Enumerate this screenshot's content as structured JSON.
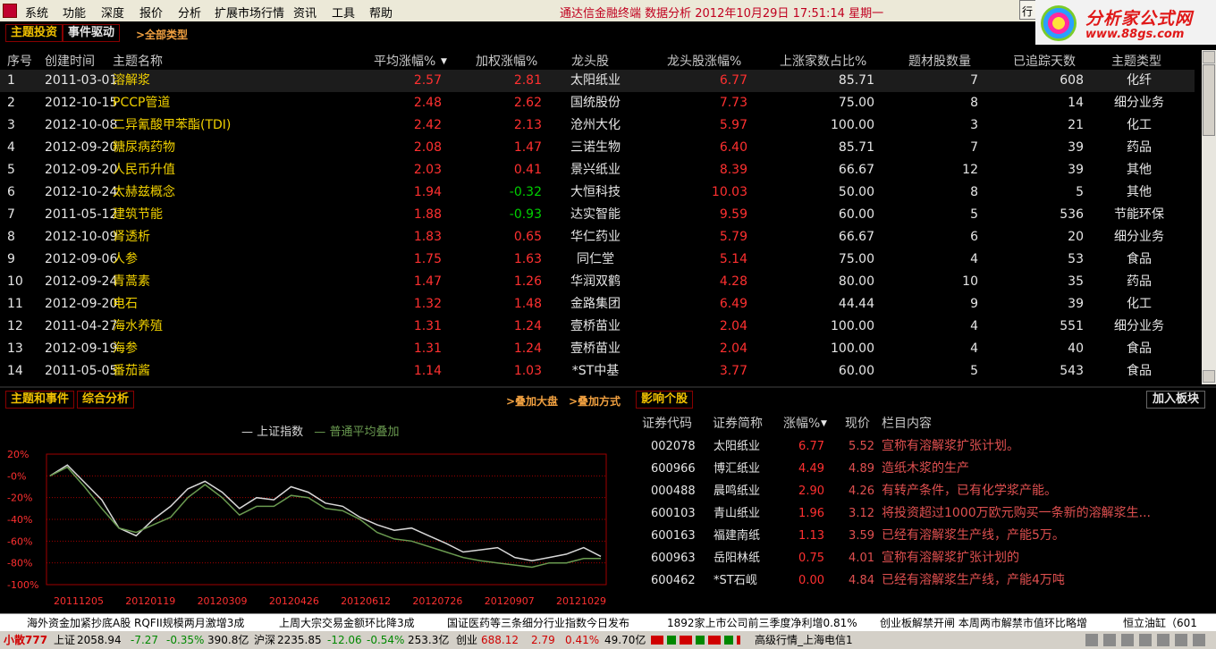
{
  "menu": [
    "系统",
    "功能",
    "深度",
    "报价",
    "分析",
    "扩展市场行情",
    "资讯",
    "工具",
    "帮助"
  ],
  "title": "通达信金融终端   数据分析  2012年10月29日  17:51:14  星期一",
  "trade_btn": "行",
  "logo": {
    "line1": "分析家公式网",
    "line2": "www.88gs.com"
  },
  "tabs": {
    "theme": "主题投资",
    "event": "事件驱动",
    "all_types": ">全部类型"
  },
  "table": {
    "headers": [
      "序号",
      "创建时间",
      "主题名称",
      "平均涨幅%",
      "加权涨幅%",
      "龙头股",
      "龙头股涨幅%",
      "上涨家数占比%",
      "题材股数量",
      "已追踪天数",
      "主题类型"
    ],
    "rows": [
      [
        "1",
        "2011-03-01",
        "溶解浆",
        "2.57",
        "2.81",
        "太阳纸业",
        "6.77",
        "85.71",
        "7",
        "608",
        "化纤"
      ],
      [
        "2",
        "2012-10-15",
        "PCCP管道",
        "2.48",
        "2.62",
        "国统股份",
        "7.73",
        "75.00",
        "8",
        "14",
        "细分业务"
      ],
      [
        "3",
        "2012-10-08",
        "二异氰酸甲苯酯(TDI)",
        "2.42",
        "2.13",
        "沧州大化",
        "5.97",
        "100.00",
        "3",
        "21",
        "化工"
      ],
      [
        "4",
        "2012-09-20",
        "糖尿病药物",
        "2.08",
        "1.47",
        "三诺生物",
        "6.40",
        "85.71",
        "7",
        "39",
        "药品"
      ],
      [
        "5",
        "2012-09-20",
        "人民币升值",
        "2.03",
        "0.41",
        "景兴纸业",
        "8.39",
        "66.67",
        "12",
        "39",
        "其他"
      ],
      [
        "6",
        "2012-10-24",
        "太赫兹概念",
        "1.94",
        "-0.32",
        "大恒科技",
        "10.03",
        "50.00",
        "8",
        "5",
        "其他"
      ],
      [
        "7",
        "2011-05-12",
        "建筑节能",
        "1.88",
        "-0.93",
        "达实智能",
        "9.59",
        "60.00",
        "5",
        "536",
        "节能环保"
      ],
      [
        "8",
        "2012-10-09",
        "肾透析",
        "1.83",
        "0.65",
        "华仁药业",
        "5.79",
        "66.67",
        "6",
        "20",
        "细分业务"
      ],
      [
        "9",
        "2012-09-06",
        "人参",
        "1.75",
        "1.63",
        "同仁堂",
        "5.14",
        "75.00",
        "4",
        "53",
        "食品"
      ],
      [
        "10",
        "2012-09-24",
        "青蒿素",
        "1.47",
        "1.26",
        "华润双鹤",
        "4.28",
        "80.00",
        "10",
        "35",
        "药品"
      ],
      [
        "11",
        "2012-09-20",
        "电石",
        "1.32",
        "1.48",
        "金路集团",
        "6.49",
        "44.44",
        "9",
        "39",
        "化工"
      ],
      [
        "12",
        "2011-04-27",
        "海水养殖",
        "1.31",
        "1.24",
        "壹桥苗业",
        "2.04",
        "100.00",
        "4",
        "551",
        "细分业务"
      ],
      [
        "13",
        "2012-09-19",
        "海参",
        "1.31",
        "1.24",
        "壹桥苗业",
        "2.04",
        "100.00",
        "4",
        "40",
        "食品"
      ],
      [
        "14",
        "2011-05-05",
        "番茄酱",
        "1.14",
        "1.03",
        "*ST中基",
        "3.77",
        "60.00",
        "5",
        "543",
        "食品"
      ]
    ]
  },
  "lower_tabs": {
    "themes_events": "主题和事件",
    "analysis": "综合分析",
    "overlay_market": ">叠加大盘",
    "overlay_mode": ">叠加方式",
    "impact": "影响个股",
    "add_board": "加入板块"
  },
  "chart_data": {
    "type": "line",
    "x": [
      "20111205",
      "20120119",
      "20120309",
      "20120426",
      "20120612",
      "20120726",
      "20120907",
      "20121029"
    ],
    "y_ticks": [
      "20%",
      "-0%",
      "-20%",
      "-40%",
      "-60%",
      "-80%",
      "-100%"
    ],
    "ylim": [
      -100,
      20
    ],
    "series": [
      {
        "name": "上证指数",
        "color": "#d8d8d8",
        "values": [
          0,
          10,
          -6,
          -22,
          -48,
          -55,
          -40,
          -28,
          -12,
          -5,
          -15,
          -30,
          -20,
          -22,
          -10,
          -15,
          -25,
          -28,
          -38,
          -45,
          -50,
          -48,
          -55,
          -62,
          -70,
          -68,
          -66,
          -75,
          -78,
          -75,
          -72,
          -66,
          -74
        ]
      },
      {
        "name": "普通平均叠加",
        "color": "#6a9a50",
        "values": [
          0,
          8,
          -10,
          -30,
          -48,
          -52,
          -45,
          -38,
          -20,
          -8,
          -20,
          -36,
          -28,
          -28,
          -18,
          -20,
          -30,
          -32,
          -40,
          -52,
          -58,
          -60,
          -65,
          -70,
          -75,
          -78,
          -80,
          -82,
          -84,
          -80,
          -80,
          -76,
          -76
        ]
      }
    ]
  },
  "impact": {
    "headers": [
      "证券代码",
      "证券简称",
      "涨幅%",
      "现价",
      "栏目内容"
    ],
    "rows": [
      [
        "002078",
        "太阳纸业",
        "6.77",
        "5.52",
        "宣称有溶解浆扩张计划。"
      ],
      [
        "600966",
        "博汇纸业",
        "4.49",
        "4.89",
        "造纸木浆的生产"
      ],
      [
        "000488",
        "晨鸣纸业",
        "2.90",
        "4.26",
        "有转产条件，已有化学浆产能。"
      ],
      [
        "600103",
        "青山纸业",
        "1.96",
        "3.12",
        "将投资超过1000万欧元购买一条新的溶解浆生..."
      ],
      [
        "600163",
        "福建南纸",
        "1.13",
        "3.59",
        "已经有溶解浆生产线，产能5万。"
      ],
      [
        "600963",
        "岳阳林纸",
        "0.75",
        "4.01",
        "宣称有溶解浆扩张计划的"
      ],
      [
        "600462",
        "*ST石岘",
        "0.00",
        "4.84",
        "已经有溶解浆生产线，产能4万吨"
      ]
    ]
  },
  "ticker": [
    "海外资金加紧抄底A股 RQFII规模两月激增3成",
    "上周大宗交易金额环比降3成",
    "国证医药等三条细分行业指数今日发布",
    "1892家上市公司前三季度净利增0.81%",
    "创业板解禁开闸 本周两市解禁市值环比略增",
    "恒立油缸（601"
  ],
  "status": {
    "xiaosan": "小散777",
    "sh_label": "上证",
    "sh_val": "2058.94",
    "sh_chg": "-7.27",
    "sh_pct": "-0.35%",
    "sh_amt": "390.8亿",
    "hs_label": "沪深",
    "hs_val": "2235.85",
    "hs_chg": "-12.06",
    "hs_pct": "-0.54%",
    "hs_amt": "253.3亿",
    "cy_label": "创业",
    "cy_val": "688.12",
    "cy_chg": "2.79",
    "cy_pct": "0.41%",
    "cy_amt": "49.70亿",
    "server": "高级行情_上海电信1"
  }
}
